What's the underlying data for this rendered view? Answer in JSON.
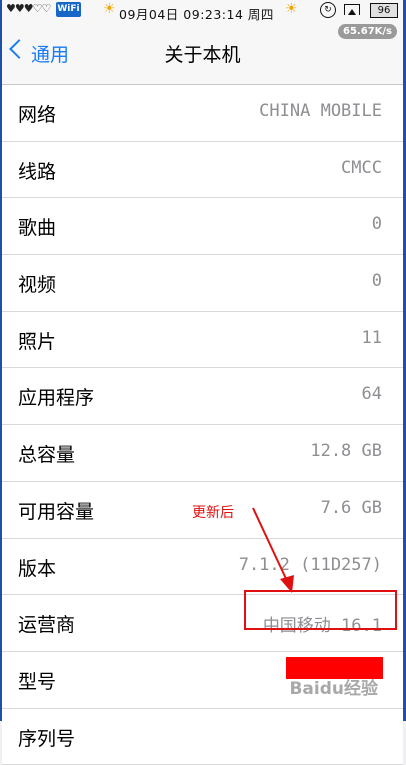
{
  "status_bar": {
    "signal_glyphs": "♥♥♥♡♡",
    "wifi_badge": "WiFi",
    "datetime": "09月04日 09:23:14 周四",
    "battery": "96"
  },
  "nav": {
    "back_label": "通用",
    "title": "关于本机",
    "speed_badge": "65.67K/s"
  },
  "rows": [
    {
      "label": "网络",
      "value": "CHINA MOBILE"
    },
    {
      "label": "线路",
      "value": "CMCC"
    },
    {
      "label": "歌曲",
      "value": "0"
    },
    {
      "label": "视频",
      "value": "0"
    },
    {
      "label": "照片",
      "value": "11"
    },
    {
      "label": "应用程序",
      "value": "64"
    },
    {
      "label": "总容量",
      "value": "12.8 GB"
    },
    {
      "label": "可用容量",
      "value": "7.6 GB"
    },
    {
      "label": "版本",
      "value": "7.1.2 (11D257)"
    },
    {
      "label": "运营商",
      "value": "中国移动 16.1"
    },
    {
      "label": "型号",
      "value": ""
    },
    {
      "label": "序列号",
      "value": ""
    }
  ],
  "annotation": {
    "label": "更新后",
    "color": "#e01010"
  },
  "watermark": "Baidu经验",
  "colors": {
    "accent": "#1a7cf4",
    "value_gray": "#8e8e93",
    "background": "#efeff4"
  },
  "icons": [
    "heart-icon",
    "wifi-icon",
    "sun-icon",
    "rotation-lock-icon",
    "airplay-icon",
    "battery-icon",
    "chevron-left-icon"
  ]
}
